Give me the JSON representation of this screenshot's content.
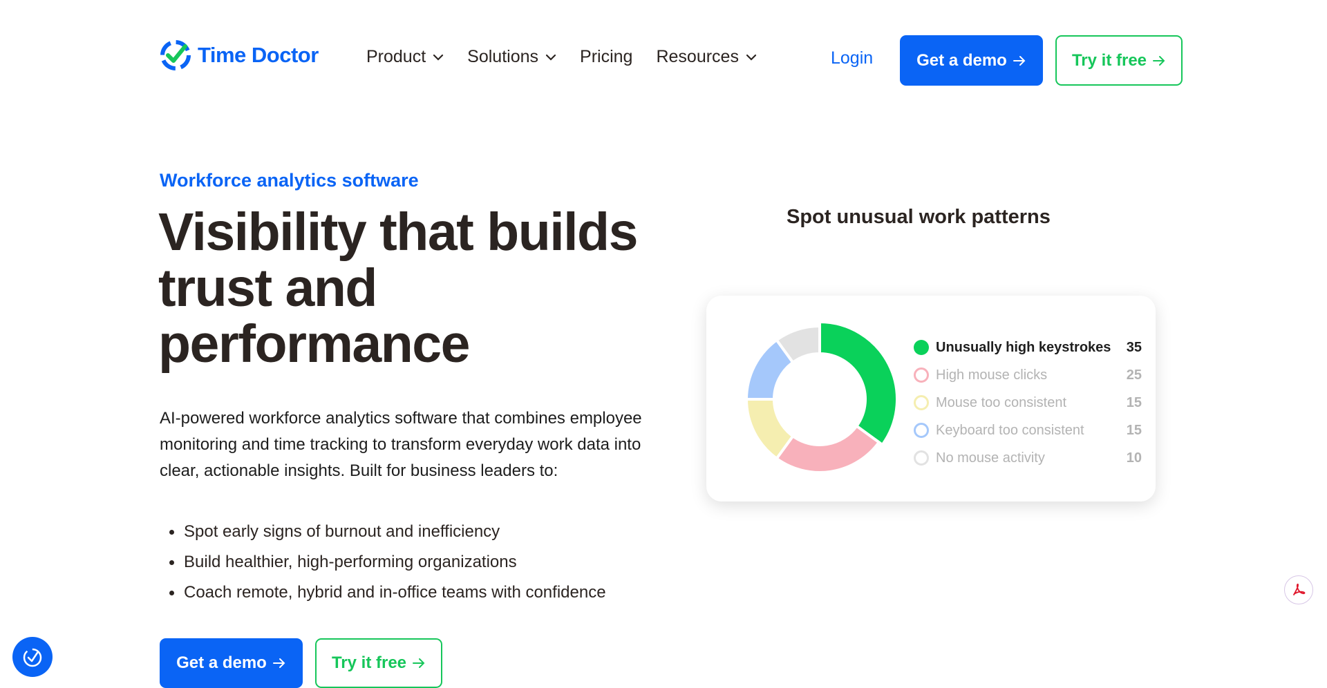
{
  "brand": {
    "name": "Time Doctor",
    "color": "#0a64f5",
    "accent": "#16c65a"
  },
  "nav": {
    "items": [
      {
        "label": "Product",
        "dropdown": true
      },
      {
        "label": "Solutions",
        "dropdown": true
      },
      {
        "label": "Pricing",
        "dropdown": false
      },
      {
        "label": "Resources",
        "dropdown": true
      }
    ],
    "login": "Login",
    "demo_label": "Get a demo",
    "try_label": "Try it free"
  },
  "hero": {
    "eyebrow": "Workforce analytics software",
    "headline": "Visibility that builds trust and performance",
    "description": "AI-powered workforce analytics software that combines employee monitoring and time tracking to transform everyday work data into clear, actionable insights. Built for business leaders to:",
    "bullets": [
      "Spot early signs of burnout and inefficiency",
      "Build healthier, high-performing organizations",
      "Coach remote, hybrid and in-office teams with confidence"
    ],
    "demo_label": "Get a demo",
    "try_label": "Try it free"
  },
  "chart_title": "Spot unusual work patterns",
  "chart_data": {
    "type": "pie",
    "title": "Spot unusual work patterns",
    "categories": [
      "Unusually high keystrokes",
      "High mouse clicks",
      "Mouse too consistent",
      "Keyboard too consistent",
      "No mouse activity"
    ],
    "values": [
      35,
      25,
      15,
      15,
      10
    ],
    "colors": [
      "#0ad15a",
      "#f8b1bb",
      "#f5eeb0",
      "#a5c8fb",
      "#e2e2e2"
    ],
    "highlighted": "Unusually high keystrokes",
    "legend": "right"
  },
  "icons": {
    "logo": "time-doctor-logo-icon",
    "chevron": "chevron-down-icon",
    "arrow": "arrow-right-icon",
    "floating_left": "time-check-icon",
    "floating_right": "pdf-icon"
  }
}
